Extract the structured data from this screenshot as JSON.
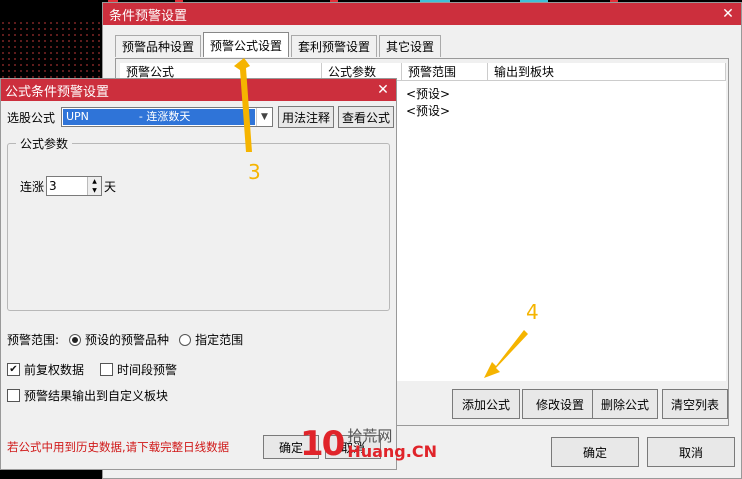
{
  "main": {
    "title": "条件预警设置",
    "tabs": [
      "预警品种设置",
      "预警公式设置",
      "套利预警设置",
      "其它设置"
    ],
    "columns": [
      "预警公式",
      "公式参数",
      "预警范围",
      "输出到板块"
    ],
    "rows": [
      "<预设>",
      "<预设>"
    ],
    "buttons": {
      "add": "添加公式",
      "modify": "修改设置",
      "delete": "删除公式",
      "clear": "清空列表",
      "ok": "确定",
      "cancel": "取消"
    }
  },
  "sub": {
    "title": "公式条件预警设置",
    "select_label": "选股公式",
    "formula_code": "UPN",
    "formula_desc": "- 连涨数天",
    "usage_btn": "用法注释",
    "view_btn": "查看公式",
    "group_title": "公式参数",
    "param_label": "连涨",
    "param_value": "3",
    "param_unit": "天",
    "range_label": "预警范围:",
    "range_opt1": "预设的预警品种",
    "range_opt2": "指定范围",
    "check1": "前复权数据",
    "check2": "时间段预警",
    "check3": "预警结果输出到自定义板块",
    "warning": "若公式中用到历史数据,请下载完整日线数据",
    "ok": "确定",
    "cancel": "取消"
  },
  "annotations": {
    "a3": "3",
    "a4": "4",
    "color": "#f5b400"
  },
  "watermark": {
    "ten": "10",
    "top": "拾荒网",
    "bottom": "Huang.CN"
  },
  "colors": {
    "titlebar": "#cc2f3d",
    "selection": "#2f74d8",
    "warning": "#d01818"
  }
}
